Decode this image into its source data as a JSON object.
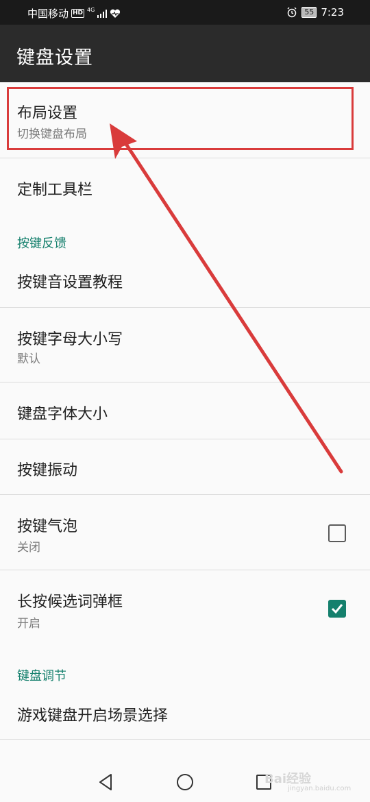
{
  "status_bar": {
    "carrier": "中国移动",
    "hd": "HD",
    "net_type": "4G",
    "battery": "55",
    "time": "7:23"
  },
  "app_bar": {
    "title": "键盘设置"
  },
  "items": {
    "layout": {
      "title": "布局设置",
      "summary": "切换键盘布局"
    },
    "toolbar": {
      "title": "定制工具栏"
    },
    "cat_feedback": "按键反馈",
    "sound_tutorial": {
      "title": "按键音设置教程"
    },
    "letter_case": {
      "title": "按键字母大小写",
      "summary": "默认"
    },
    "font_size": {
      "title": "键盘字体大小"
    },
    "vibration": {
      "title": "按键振动"
    },
    "bubble": {
      "title": "按键气泡",
      "summary": "关闭",
      "checked": false
    },
    "long_press": {
      "title": "长按候选词弹框",
      "summary": "开启",
      "checked": true
    },
    "cat_adjust": "键盘调节",
    "game_keyboard": {
      "title": "游戏键盘开启场景选择"
    }
  },
  "annotation_color": "#d93b3b",
  "accent_color": "#15806d",
  "watermark": {
    "main": "Bai经验",
    "sub": "jingyan.baidu.com"
  }
}
